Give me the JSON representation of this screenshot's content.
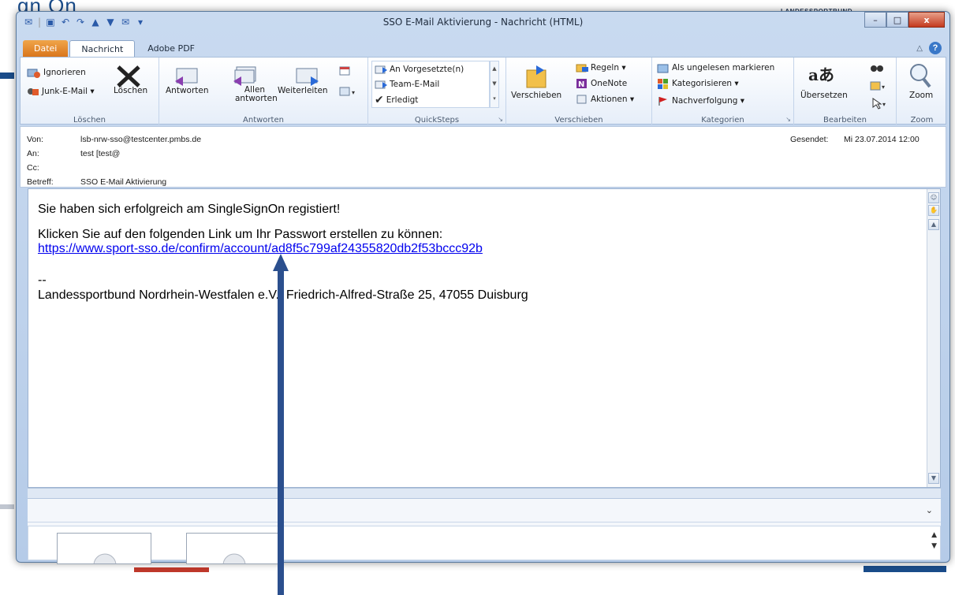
{
  "background": {
    "page_title_fragment": "gn On",
    "brand_fragment": "LANDESSPORTBUND"
  },
  "window": {
    "title": "SSO E-Mail Aktivierung  -  Nachricht (HTML)",
    "buttons": {
      "minimize": "–",
      "maximize": "□",
      "close": "x"
    }
  },
  "tabs": [
    "Datei",
    "Nachricht",
    "Adobe PDF"
  ],
  "ribbon": {
    "groups": {
      "loeschen": {
        "label": "Löschen",
        "ignore": "Ignorieren",
        "junk": "Junk-E-Mail ▾",
        "delete": "Löschen"
      },
      "antworten": {
        "label": "Antworten",
        "reply": "Antworten",
        "reply_all": "Allen antworten",
        "forward": "Weiterleiten"
      },
      "quicksteps": {
        "label": "QuickSteps",
        "items": [
          "An Vorgesetzte(n)",
          "Team-E-Mail",
          "Erledigt"
        ]
      },
      "verschieben": {
        "label": "Verschieben",
        "move": "Verschieben",
        "rules": "Regeln ▾",
        "onenote": "OneNote",
        "actions": "Aktionen ▾"
      },
      "kategorien": {
        "label": "Kategorien",
        "unread": "Als ungelesen markieren",
        "categorize": "Kategorisieren ▾",
        "followup": "Nachverfolgung ▾"
      },
      "bearbeiten": {
        "label": "Bearbeiten",
        "translate": "Übersetzen"
      },
      "zoom": {
        "label": "Zoom",
        "zoom": "Zoom"
      }
    }
  },
  "header": {
    "from_label": "Von:",
    "from_value": "lsb-nrw-sso@testcenter.pmbs.de",
    "to_label": "An:",
    "to_value": "test [test@",
    "cc_label": "Cc:",
    "subject_label": "Betreff:",
    "subject_value": "SSO E-Mail Aktivierung",
    "sent_label": "Gesendet:",
    "sent_value": "Mi 23.07.2014 12:00"
  },
  "body": {
    "line1": "Sie haben sich erfolgreich am SingleSignOn registiert!",
    "line2": "Klicken Sie auf den folgenden Link um Ihr Passwort erstellen zu können:",
    "link": "https://www.sport-sso.de/confirm/account/ad8f5c799af24355820db2f53bccc92b",
    "sig_sep": "--",
    "signature": "Landessportbund Nordrhein-Westfalen e.V., Friedrich-Alfred-Straße 25, 47055 Duisburg"
  },
  "colors": {
    "link": "#0000ee",
    "file_tab": "#e08a2a",
    "annotation_arrow": "#2b4f8e"
  }
}
